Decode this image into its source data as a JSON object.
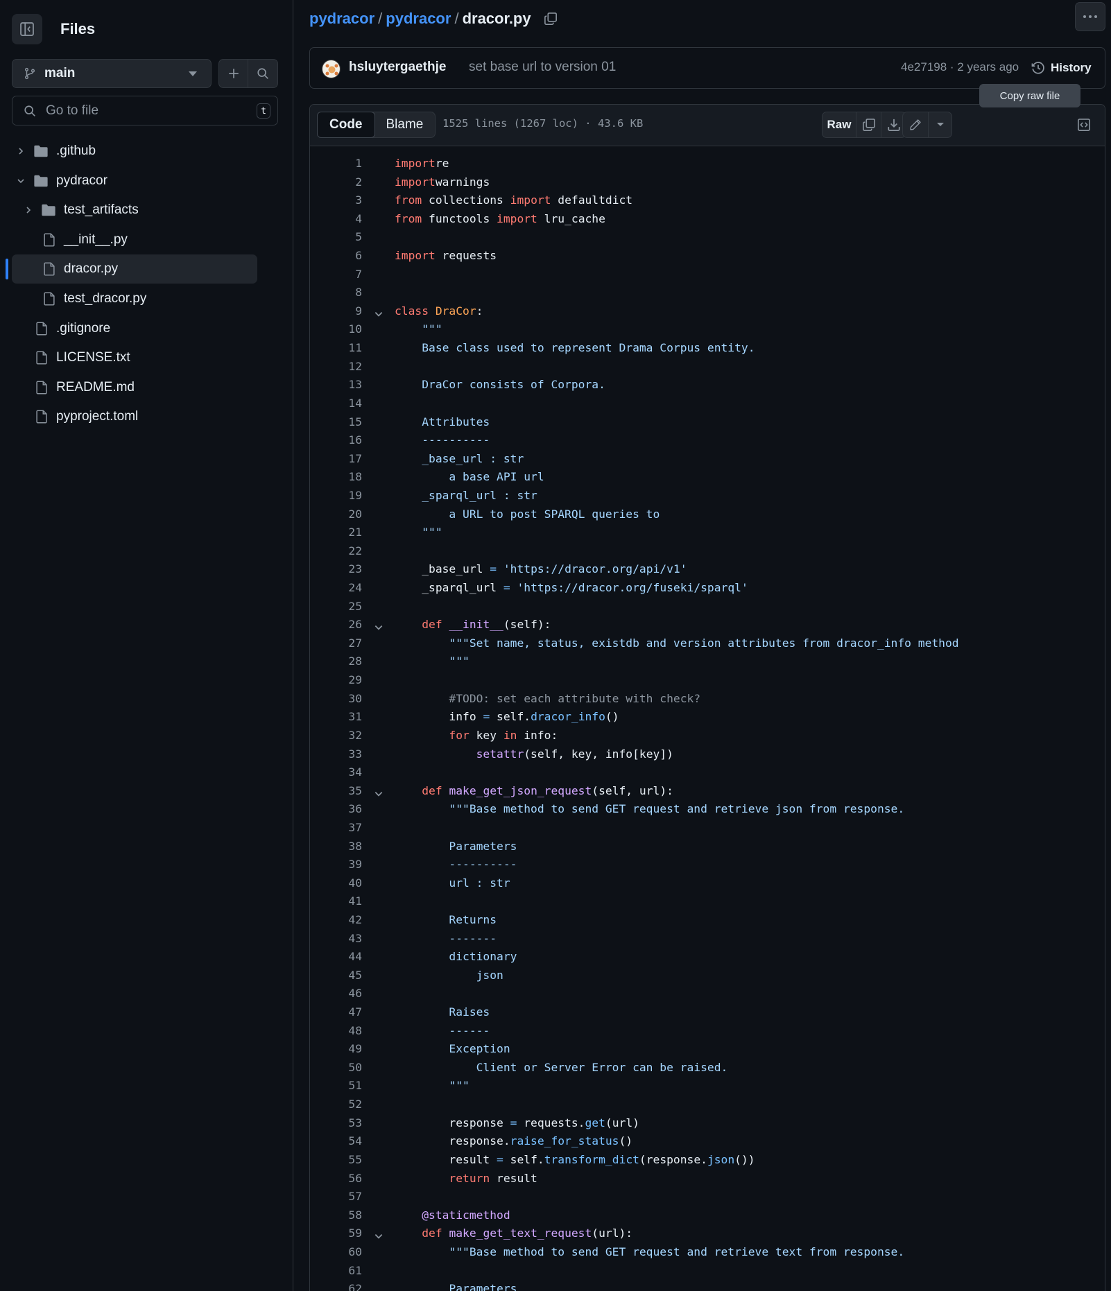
{
  "sidebar": {
    "title": "Files",
    "branch": "main",
    "goto_placeholder": "Go to file",
    "goto_shortcut": "t",
    "tree": [
      {
        "name": ".github",
        "type": "folder",
        "depth": 0,
        "expanded": false,
        "selected": false
      },
      {
        "name": "pydracor",
        "type": "folder",
        "depth": 0,
        "expanded": true,
        "selected": false
      },
      {
        "name": "test_artifacts",
        "type": "folder",
        "depth": 1,
        "expanded": false,
        "selected": false
      },
      {
        "name": "__init__.py",
        "type": "file",
        "depth": 1,
        "selected": false
      },
      {
        "name": "dracor.py",
        "type": "file",
        "depth": 1,
        "selected": true
      },
      {
        "name": "test_dracor.py",
        "type": "file",
        "depth": 1,
        "selected": false
      },
      {
        "name": ".gitignore",
        "type": "file",
        "depth": 0,
        "selected": false
      },
      {
        "name": "LICENSE.txt",
        "type": "file",
        "depth": 0,
        "selected": false
      },
      {
        "name": "README.md",
        "type": "file",
        "depth": 0,
        "selected": false
      },
      {
        "name": "pyproject.toml",
        "type": "file",
        "depth": 0,
        "selected": false
      }
    ]
  },
  "breadcrumb": {
    "repo": "pydracor",
    "sep1": "/",
    "folder": "pydracor",
    "sep2": "/",
    "file": "dracor.py"
  },
  "commit": {
    "author": "hsluytergaethje",
    "message": "set base url to version 01",
    "meta": "4e27198 · 2 years ago",
    "history_label": "History"
  },
  "tooltip": "Copy raw file",
  "toolbar": {
    "tab_code": "Code",
    "tab_blame": "Blame",
    "file_meta": "1525 lines (1267 loc) · 43.6 KB",
    "raw_label": "Raw"
  },
  "colors": {
    "accent": "#4493f8",
    "keyword": "#ff7b72",
    "string": "#a5d6ff",
    "function": "#d2a8ff",
    "class": "#ffa657",
    "comment": "#8b949e"
  },
  "code_lines": [
    {
      "n": "1",
      "fold": false,
      "tokens": [
        [
          "kw",
          "import"
        ],
        [
          "",
          "re"
        ]
      ]
    },
    {
      "n": "2",
      "fold": false,
      "tokens": [
        [
          "kw",
          "import"
        ],
        [
          "",
          "warnings"
        ]
      ]
    },
    {
      "n": "3",
      "fold": false,
      "tokens": [
        [
          "kw",
          "from"
        ],
        [
          "",
          " collections "
        ],
        [
          "kw",
          "import"
        ],
        [
          "",
          " defaultdict"
        ]
      ]
    },
    {
      "n": "4",
      "fold": false,
      "tokens": [
        [
          "kw",
          "from"
        ],
        [
          "",
          " functools "
        ],
        [
          "kw",
          "import"
        ],
        [
          "",
          " lru_cache"
        ]
      ]
    },
    {
      "n": "5",
      "fold": false,
      "tokens": []
    },
    {
      "n": "6",
      "fold": false,
      "tokens": [
        [
          "kw",
          "import"
        ],
        [
          "",
          " requests"
        ]
      ]
    },
    {
      "n": "7",
      "fold": false,
      "tokens": []
    },
    {
      "n": "8",
      "fold": false,
      "tokens": []
    },
    {
      "n": "9",
      "fold": true,
      "tokens": [
        [
          "kw",
          "class"
        ],
        [
          "",
          " "
        ],
        [
          "cls",
          "DraCor"
        ],
        [
          "",
          ":"
        ]
      ]
    },
    {
      "n": "10",
      "fold": false,
      "tokens": [
        [
          "str",
          "    \"\"\""
        ]
      ]
    },
    {
      "n": "11",
      "fold": false,
      "tokens": [
        [
          "str",
          "    Base class used to represent Drama Corpus entity."
        ]
      ]
    },
    {
      "n": "12",
      "fold": false,
      "tokens": []
    },
    {
      "n": "13",
      "fold": false,
      "tokens": [
        [
          "str",
          "    DraCor consists of Corpora."
        ]
      ]
    },
    {
      "n": "14",
      "fold": false,
      "tokens": []
    },
    {
      "n": "15",
      "fold": false,
      "tokens": [
        [
          "str",
          "    Attributes"
        ]
      ]
    },
    {
      "n": "16",
      "fold": false,
      "tokens": [
        [
          "str",
          "    ----------"
        ]
      ]
    },
    {
      "n": "17",
      "fold": false,
      "tokens": [
        [
          "str",
          "    _base_url : str"
        ]
      ]
    },
    {
      "n": "18",
      "fold": false,
      "tokens": [
        [
          "str",
          "        a base API url"
        ]
      ]
    },
    {
      "n": "19",
      "fold": false,
      "tokens": [
        [
          "str",
          "    _sparql_url : str"
        ]
      ]
    },
    {
      "n": "20",
      "fold": false,
      "tokens": [
        [
          "str",
          "        a URL to post SPARQL queries to"
        ]
      ]
    },
    {
      "n": "21",
      "fold": false,
      "tokens": [
        [
          "str",
          "    \"\"\""
        ]
      ]
    },
    {
      "n": "22",
      "fold": false,
      "tokens": []
    },
    {
      "n": "23",
      "fold": false,
      "tokens": [
        [
          "",
          "    _base_url "
        ],
        [
          "op",
          "="
        ],
        [
          "",
          " "
        ],
        [
          "str",
          "'https://dracor.org/api/v1'"
        ]
      ]
    },
    {
      "n": "24",
      "fold": false,
      "tokens": [
        [
          "",
          "    _sparql_url "
        ],
        [
          "op",
          "="
        ],
        [
          "",
          " "
        ],
        [
          "str",
          "'https://dracor.org/fuseki/sparql'"
        ]
      ]
    },
    {
      "n": "25",
      "fold": false,
      "tokens": []
    },
    {
      "n": "26",
      "fold": true,
      "tokens": [
        [
          "kw",
          "    def"
        ],
        [
          "",
          " "
        ],
        [
          "fn",
          "__init__"
        ],
        [
          "",
          "(self):"
        ]
      ]
    },
    {
      "n": "27",
      "fold": false,
      "tokens": [
        [
          "str",
          "        \"\"\"Set name, status, existdb and version attributes from dracor_info method"
        ]
      ]
    },
    {
      "n": "28",
      "fold": false,
      "tokens": [
        [
          "str",
          "        \"\"\""
        ]
      ]
    },
    {
      "n": "29",
      "fold": false,
      "tokens": []
    },
    {
      "n": "30",
      "fold": false,
      "tokens": [
        [
          "cm",
          "        #TODO: set each attribute with check?"
        ]
      ]
    },
    {
      "n": "31",
      "fold": false,
      "tokens": [
        [
          "",
          "        info "
        ],
        [
          "op",
          "="
        ],
        [
          "",
          " self."
        ],
        [
          "call",
          "dracor_info"
        ],
        [
          "",
          "()"
        ]
      ]
    },
    {
      "n": "32",
      "fold": false,
      "tokens": [
        [
          "kw",
          "        for"
        ],
        [
          "",
          " key "
        ],
        [
          "kw",
          "in"
        ],
        [
          "",
          " info:"
        ]
      ]
    },
    {
      "n": "33",
      "fold": false,
      "tokens": [
        [
          "fn",
          "            setattr"
        ],
        [
          "",
          "(self, key, info[key])"
        ]
      ]
    },
    {
      "n": "34",
      "fold": false,
      "tokens": []
    },
    {
      "n": "35",
      "fold": true,
      "tokens": [
        [
          "kw",
          "    def"
        ],
        [
          "",
          " "
        ],
        [
          "fn",
          "make_get_json_request"
        ],
        [
          "",
          "(self, url):"
        ]
      ]
    },
    {
      "n": "36",
      "fold": false,
      "tokens": [
        [
          "str",
          "        \"\"\"Base method to send GET request and retrieve json from response."
        ]
      ]
    },
    {
      "n": "37",
      "fold": false,
      "tokens": []
    },
    {
      "n": "38",
      "fold": false,
      "tokens": [
        [
          "str",
          "        Parameters"
        ]
      ]
    },
    {
      "n": "39",
      "fold": false,
      "tokens": [
        [
          "str",
          "        ----------"
        ]
      ]
    },
    {
      "n": "40",
      "fold": false,
      "tokens": [
        [
          "str",
          "        url : str"
        ]
      ]
    },
    {
      "n": "41",
      "fold": false,
      "tokens": []
    },
    {
      "n": "42",
      "fold": false,
      "tokens": [
        [
          "str",
          "        Returns"
        ]
      ]
    },
    {
      "n": "43",
      "fold": false,
      "tokens": [
        [
          "str",
          "        -------"
        ]
      ]
    },
    {
      "n": "44",
      "fold": false,
      "tokens": [
        [
          "str",
          "        dictionary"
        ]
      ]
    },
    {
      "n": "45",
      "fold": false,
      "tokens": [
        [
          "str",
          "            json"
        ]
      ]
    },
    {
      "n": "46",
      "fold": false,
      "tokens": []
    },
    {
      "n": "47",
      "fold": false,
      "tokens": [
        [
          "str",
          "        Raises"
        ]
      ]
    },
    {
      "n": "48",
      "fold": false,
      "tokens": [
        [
          "str",
          "        ------"
        ]
      ]
    },
    {
      "n": "49",
      "fold": false,
      "tokens": [
        [
          "str",
          "        Exception"
        ]
      ]
    },
    {
      "n": "50",
      "fold": false,
      "tokens": [
        [
          "str",
          "            Client or Server Error can be raised."
        ]
      ]
    },
    {
      "n": "51",
      "fold": false,
      "tokens": [
        [
          "str",
          "        \"\"\""
        ]
      ]
    },
    {
      "n": "52",
      "fold": false,
      "tokens": []
    },
    {
      "n": "53",
      "fold": false,
      "tokens": [
        [
          "",
          "        response "
        ],
        [
          "op",
          "="
        ],
        [
          "",
          " requests."
        ],
        [
          "call",
          "get"
        ],
        [
          "",
          "(url)"
        ]
      ]
    },
    {
      "n": "54",
      "fold": false,
      "tokens": [
        [
          "",
          "        response."
        ],
        [
          "call",
          "raise_for_status"
        ],
        [
          "",
          "()"
        ]
      ]
    },
    {
      "n": "55",
      "fold": false,
      "tokens": [
        [
          "",
          "        result "
        ],
        [
          "op",
          "="
        ],
        [
          "",
          " self."
        ],
        [
          "call",
          "transform_dict"
        ],
        [
          "",
          "(response."
        ],
        [
          "call",
          "json"
        ],
        [
          "",
          "())"
        ]
      ]
    },
    {
      "n": "56",
      "fold": false,
      "tokens": [
        [
          "kw",
          "        return"
        ],
        [
          "",
          " result"
        ]
      ]
    },
    {
      "n": "57",
      "fold": false,
      "tokens": []
    },
    {
      "n": "58",
      "fold": false,
      "tokens": [
        [
          "fn",
          "    @staticmethod"
        ]
      ]
    },
    {
      "n": "59",
      "fold": true,
      "tokens": [
        [
          "kw",
          "    def"
        ],
        [
          "",
          " "
        ],
        [
          "fn",
          "make_get_text_request"
        ],
        [
          "",
          "(url):"
        ]
      ]
    },
    {
      "n": "60",
      "fold": false,
      "tokens": [
        [
          "str",
          "        \"\"\"Base method to send GET request and retrieve text from response."
        ]
      ]
    },
    {
      "n": "61",
      "fold": false,
      "tokens": []
    },
    {
      "n": "62",
      "fold": false,
      "tokens": [
        [
          "str",
          "        Parameters"
        ]
      ]
    }
  ]
}
